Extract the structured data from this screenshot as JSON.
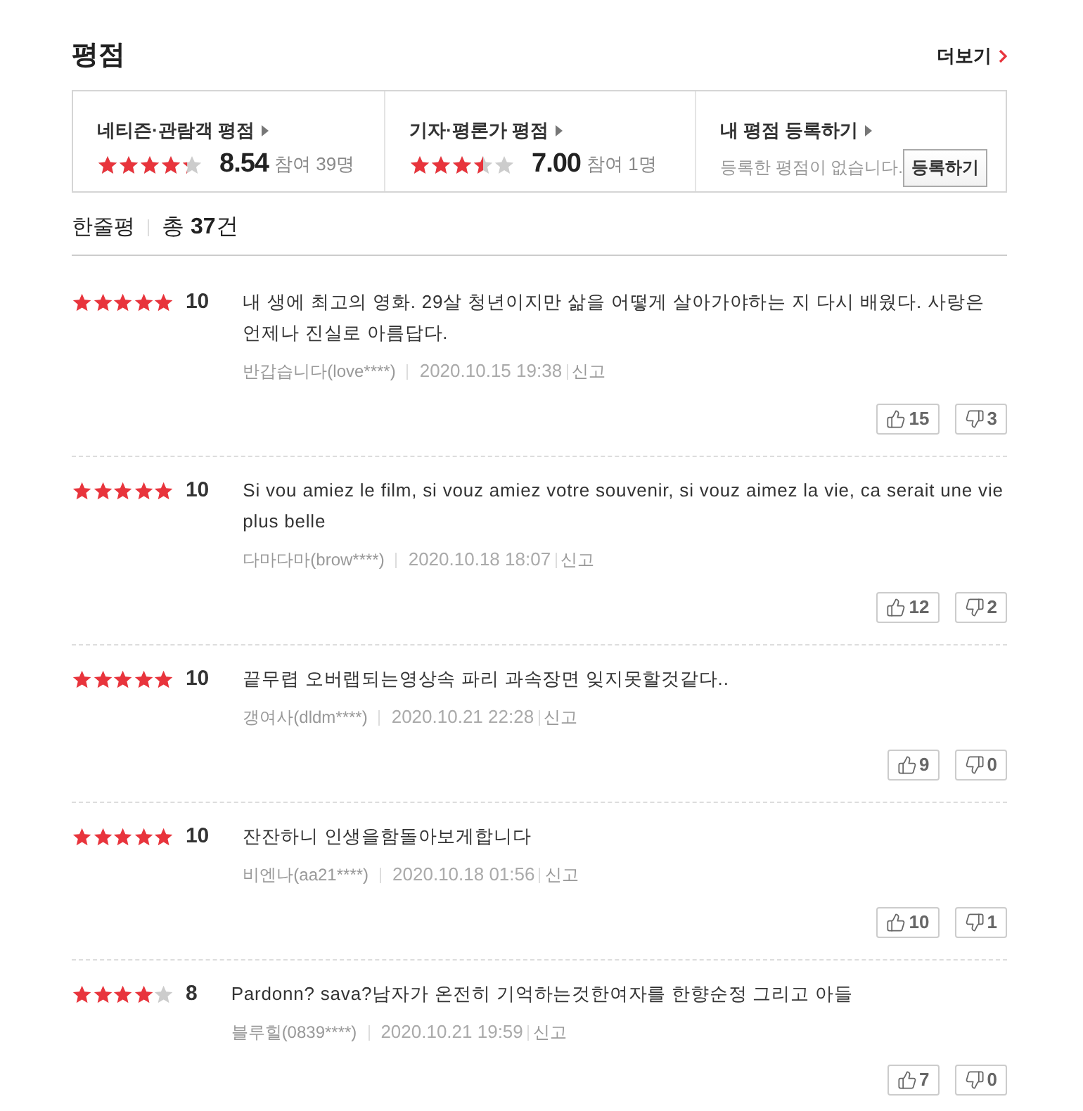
{
  "section": {
    "title": "평점",
    "more_link": "더보기"
  },
  "ratings": [
    {
      "kind": "score",
      "label": "네티즌·관람객 평점",
      "level": 0.854,
      "score": "8.54",
      "participants": "참여 39명"
    },
    {
      "kind": "score",
      "label": "기자·평론가 평점",
      "level": 0.7,
      "score": "7.00",
      "participants": "참여 1명"
    },
    {
      "kind": "register",
      "label": "내 평점 등록하기",
      "message": "등록한 평점이 없습니다.",
      "button": "등록하기"
    }
  ],
  "reviews_header": {
    "title": "한줄평",
    "count": "총 **37**건"
  },
  "reviews": [
    {
      "stars": 5,
      "score": "10",
      "text": "내 생에 최고의 영화. 29살 청년이지만 삶을 어떻게 살아가야하는 지 다시 배웠다. 사랑은 언제나 진실로 아름답다.",
      "author": "반갑습니다(love****)",
      "date": "2020.10.15 19:38",
      "report": "신고",
      "likes": "15",
      "dislikes": "3"
    },
    {
      "stars": 5,
      "score": "10",
      "text": "Si vou amiez le film, si vouz amiez votre souvenir, si vouz aimez la vie, ca serait une vie plus belle",
      "author": "다마다마(brow****)",
      "date": "2020.10.18 18:07",
      "report": "신고",
      "likes": "12",
      "dislikes": "2"
    },
    {
      "stars": 5,
      "score": "10",
      "text": "끝무렵 오버랩되는영상속 파리 과속장면 잊지못할것같다..",
      "author": "갱여사(dldm****)",
      "date": "2020.10.21 22:28",
      "report": "신고",
      "likes": "9",
      "dislikes": "0"
    },
    {
      "stars": 5,
      "score": "10",
      "text": "잔잔하니 인생을함돌아보게합니다",
      "author": "비엔나(aa21****)",
      "date": "2020.10.18 01:56",
      "report": "신고",
      "likes": "10",
      "dislikes": "1"
    },
    {
      "stars": 4,
      "score": "8",
      "text": "Pardonn? sava?남자가 온전히 기억하는것한여자를 한향순정 그리고 아들",
      "author": "블루힐(0839****)",
      "date": "2020.10.21 19:59",
      "report": "신고",
      "likes": "7",
      "dislikes": "0"
    }
  ]
}
